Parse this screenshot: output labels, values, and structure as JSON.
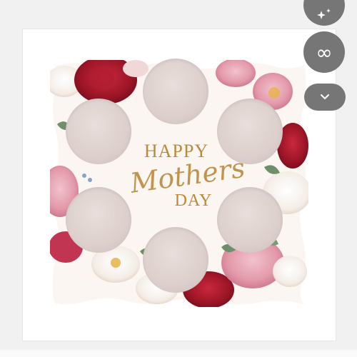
{
  "image": {
    "subject": "mothers-day-cupcake-box",
    "text": {
      "line1": "HAPPY",
      "line2": "Mothers",
      "line3": "DAY"
    },
    "colors": {
      "background": "#f1f1f1",
      "box": "#ffffff",
      "gold_text": "#b98a3c",
      "hole": "#dccfcc",
      "rose_red": "#a3182b",
      "rose_pink": "#e8a4b4"
    }
  },
  "side_buttons": [
    {
      "icon": "sparkle-icon"
    },
    {
      "icon": "infinity-icon"
    },
    {
      "icon": "chevron-down-icon"
    }
  ]
}
